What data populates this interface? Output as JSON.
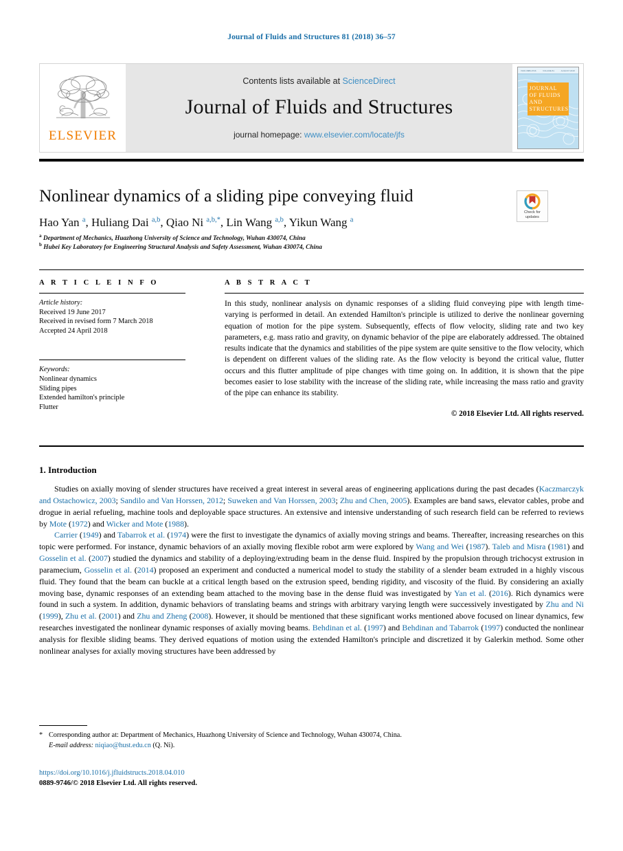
{
  "running_head": "Journal of Fluids and Structures 81 (2018) 36–57",
  "masthead": {
    "publisher_name": "ELSEVIER",
    "publisher_logo_icon": "elsevier-tree-logo",
    "contents_prefix": "Contents lists available at ",
    "contents_link": "ScienceDirect",
    "journal_name": "Journal of Fluids and Structures",
    "homepage_prefix": "journal homepage: ",
    "homepage_url": "www.elsevier.com/locate/jfs",
    "cover_title": "JOURNAL OF FLUIDS AND STRUCTURES",
    "cover_topbar_left": "ISSN 0889-9746",
    "cover_topbar_mid": "VOLUME 81",
    "cover_topbar_right": "AUGUST 2018"
  },
  "article": {
    "title": "Nonlinear dynamics of a sliding pipe conveying fluid",
    "authors_html": "Hao Yan <sup>a</sup>, Huliang Dai <sup>a,b</sup>, Qiao Ni <sup>a,b,*</sup>, Lin Wang <sup>a,b</sup>, Yikun Wang <sup>a</sup>",
    "affiliation_a": "Department of Mechanics, Huazhong University of Science and Technology, Wuhan 430074, China",
    "affiliation_b": "Hubei Key Laboratory for Engineering Structural Analysis and Safety Assessment, Wuhan 430074, China",
    "crossmark_label_line1": "Check for",
    "crossmark_label_line2": "updates"
  },
  "article_info": {
    "heading": "A R T I C L E   I N F O",
    "history_label": "Article history:",
    "history": [
      "Received 19 June 2017",
      "Received in revised form 7 March 2018",
      "Accepted 24 April 2018"
    ],
    "keywords_label": "Keywords:",
    "keywords": [
      "Nonlinear dynamics",
      "Sliding pipes",
      "Extended hamilton's principle",
      "Flutter"
    ]
  },
  "abstract": {
    "heading": "A B S T R A C T",
    "text": "In this study, nonlinear analysis on dynamic responses of a sliding fluid conveying pipe with length time-varying is performed in detail. An extended Hamilton's principle is utilized to derive the nonlinear governing equation of motion for the pipe system. Subsequently, effects of flow velocity, sliding rate and two key parameters, e.g. mass ratio and gravity, on dynamic behavior of the pipe are elaborately addressed. The obtained results indicate that the dynamics and stabilities of the pipe system are quite sensitive to the flow velocity, which is dependent on different values of the sliding rate. As the flow velocity is beyond the critical value, flutter occurs and this flutter amplitude of pipe changes with time going on. In addition, it is shown that the pipe becomes easier to lose stability with the increase of the sliding rate, while increasing the mass ratio and gravity of the pipe can enhance its stability.",
    "copyright": "© 2018 Elsevier Ltd. All rights reserved."
  },
  "introduction": {
    "heading": "1. Introduction",
    "para1_html": "Studies on axially moving of slender structures have received a great interest in several areas of engineering applications during the past decades (<span class=\"ref\">Kaczmarczyk and Ostachowicz, 2003</span>; <span class=\"ref\">Sandilo and Van Horssen, 2012</span>; <span class=\"ref\">Suweken and Van Horssen, 2003</span>; <span class=\"ref\">Zhu and Chen, 2005</span>). Examples are band saws, elevator cables, probe and drogue in aerial refueling, machine tools and deployable space structures. An extensive and intensive understanding of such research field can be referred to reviews by <span class=\"ref\">Mote</span> (<span class=\"ref\">1972</span>) and <span class=\"ref\">Wicker and Mote</span> (<span class=\"ref\">1988</span>).",
    "para2_html": "<span class=\"ref\">Carrier</span> (<span class=\"ref\">1949</span>) and <span class=\"ref\">Tabarrok et al.</span> (<span class=\"ref\">1974</span>) were the first to investigate the dynamics of axially moving strings and beams. Thereafter, increasing researches on this topic were performed. For instance, dynamic behaviors of an axially moving flexible robot arm were explored by <span class=\"ref\">Wang and Wei</span> (<span class=\"ref\">1987</span>). <span class=\"ref\">Taleb and Misra</span> (<span class=\"ref\">1981</span>) and <span class=\"ref\">Gosselin et al.</span> (<span class=\"ref\">2007</span>) studied the dynamics and stability of a deploying/extruding beam in the dense fluid. Inspired by the propulsion through trichocyst extrusion in paramecium, <span class=\"ref\">Gosselin et al.</span> (<span class=\"ref\">2014</span>) proposed an experiment and conducted a numerical model to study the stability of a slender beam extruded in a highly viscous fluid. They found that the beam can buckle at a critical length based on the extrusion speed, bending rigidity, and viscosity of the fluid. By considering an axially moving base, dynamic responses of an extending beam attached to the moving base in the dense fluid was investigated by <span class=\"ref\">Yan et al.</span> (<span class=\"ref\">2016</span>). Rich dynamics were found in such a system. In addition, dynamic behaviors of translating beams and strings with arbitrary varying length were successively investigated by <span class=\"ref\">Zhu and Ni</span> (<span class=\"ref\">1999</span>), <span class=\"ref\">Zhu et al.</span> (<span class=\"ref\">2001</span>) and <span class=\"ref\">Zhu and Zheng</span> (<span class=\"ref\">2008</span>). However, it should be mentioned that these significant works mentioned above focused on linear dynamics, few researches investigated the nonlinear dynamic responses of axially moving beams. <span class=\"ref\">Behdinan et al.</span> (<span class=\"ref\">1997</span>) and <span class=\"ref\">Behdinan and Tabarrok</span> (<span class=\"ref\">1997</span>) conducted the nonlinear analysis for flexible sliding beams. They derived equations of motion using the extended Hamilton's principle and discretized it by Galerkin method. Some other nonlinear analyses for axially moving structures have been addressed by"
  },
  "footnotes": {
    "corresponding": "Corresponding author at: Department of Mechanics, Huazhong University of Science and Technology, Wuhan 430074, China.",
    "email_label": "E-mail address:",
    "email": "niqiao@hust.edu.cn",
    "email_suffix": "(Q. Ni).",
    "doi": "https://doi.org/10.1016/j.jfluidstructs.2018.04.010",
    "issn_line": "0889-9746/© 2018 Elsevier Ltd. All rights reserved."
  },
  "colors": {
    "link_blue": "#1a6fa8",
    "science_direct_blue": "#3f8fc4",
    "elsevier_orange": "#f07c00",
    "cover_orange": "#f5a623",
    "banner_grey": "#e6e6e6"
  }
}
